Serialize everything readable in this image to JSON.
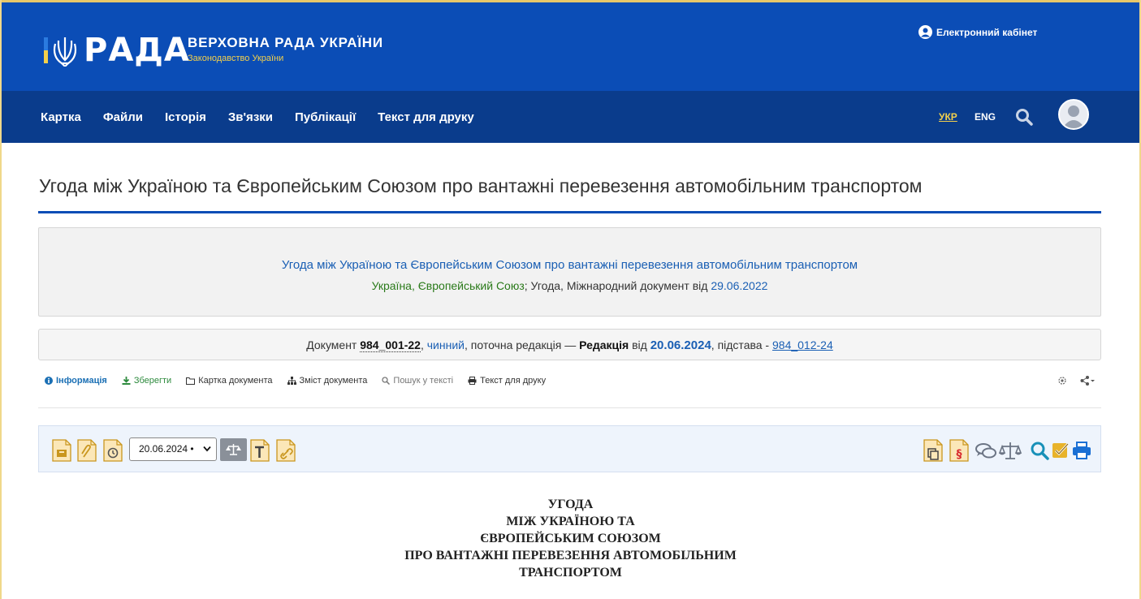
{
  "header": {
    "logo_word": "РАДА",
    "title": "ВЕРХОВНА РАДА УКРАЇНИ",
    "subtitle": "Законодавство України",
    "cabinet_label": "Електронний кабінет"
  },
  "nav": {
    "tabs": [
      "Картка",
      "Файли",
      "Історія",
      "Зв'язки",
      "Публікації",
      "Текст для друку"
    ],
    "lang_ukr": "УКР",
    "lang_eng": "ENG"
  },
  "page": {
    "title": "Угода між Україною та Європейським Союзом про вантажні перевезення автомобільним транспортом"
  },
  "info_box": {
    "line1": "Угода між Україною та Європейським Союзом про вантажні перевезення автомобільним транспортом",
    "parties": "Україна, Європейський Союз",
    "type_text": "; Угода, Міжнародний документ від ",
    "date": "29.06.2022"
  },
  "status": {
    "prefix": "Документ ",
    "doc_number": "984_001-22",
    "comma1": ", ",
    "state": "чинний",
    "middle": ", поточна редакція — ",
    "edition_label": "Редакція",
    "from": " від ",
    "edition_date": "20.06.2024",
    "basis_label": ", підстава - ",
    "basis_link": "984_012-24"
  },
  "small_toolbar": {
    "info": "Інформація",
    "save": "Зберегти",
    "card": "Картка документа",
    "contents": "Зміст документа",
    "search": "Пошук у тексті",
    "print": "Текст для друку"
  },
  "icon_bar": {
    "selected_date": "20.06.2024 •"
  },
  "document": {
    "heading_lines": [
      "УГОДА",
      "МІЖ УКРАЇНОЮ ТА",
      "ЄВРОПЕЙСЬКИМ СОЮЗОМ",
      "ПРО ВАНТАЖНІ ПЕРЕВЕЗЕННЯ АВТОМОБІЛЬНИМ",
      "ТРАНСПОРТОМ"
    ]
  },
  "colors": {
    "banner_blue": "#0b4db6",
    "nav_navy": "#0a3c8c",
    "accent_yellow": "#f3d04c",
    "link_blue": "#1a5fb4",
    "party_green": "#2a7a1a"
  }
}
